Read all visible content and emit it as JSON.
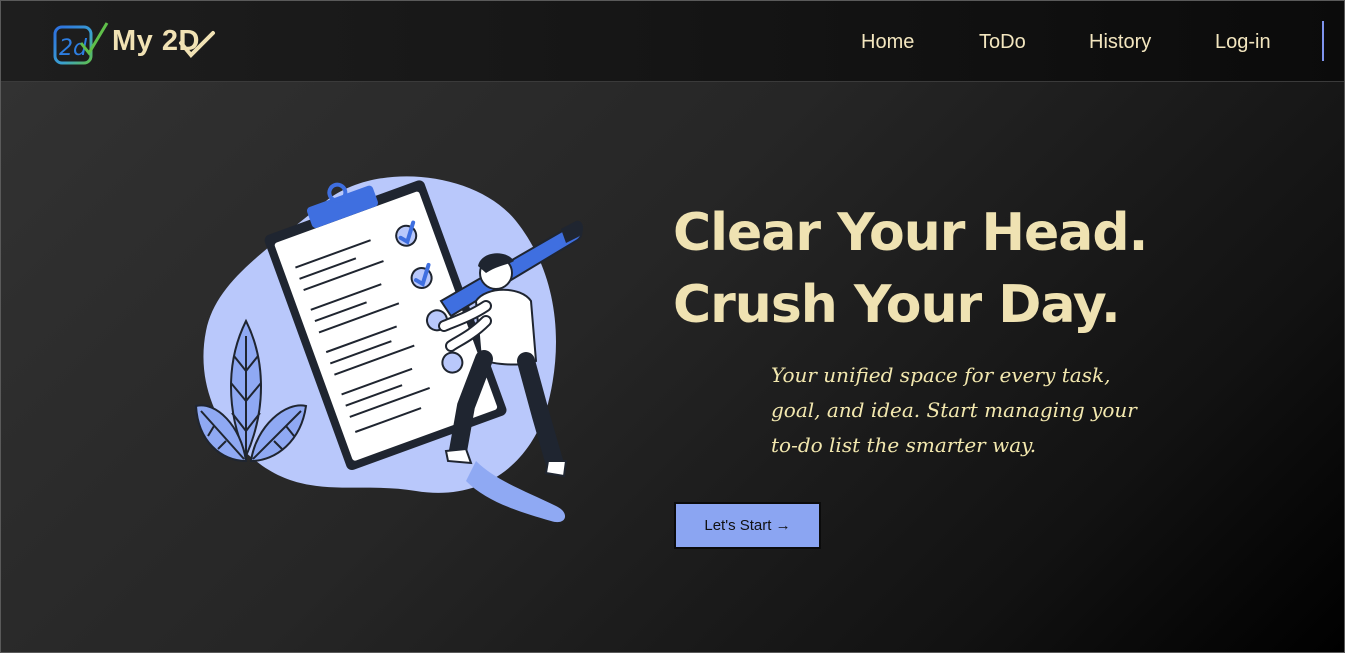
{
  "nav": {
    "brand": "My 2D",
    "links": [
      {
        "label": "Home"
      },
      {
        "label": "ToDo"
      },
      {
        "label": "History"
      },
      {
        "label": "Log-in"
      }
    ]
  },
  "hero": {
    "headline_line1": "Clear Your Head.",
    "headline_line2": "Crush Your Day.",
    "subtext": "Your unified space for every task, goal, and idea. Start managing your to-do list the smarter way.",
    "cta_label": "Let's Start →"
  },
  "colors": {
    "accent": "#8ba5f2",
    "headline": "#efe2b2",
    "nav_text": "#f3e6bf",
    "illustration_blue": "#3f6fe0",
    "illustration_light": "#b9c8fb"
  },
  "icons": [
    "logo-icon",
    "checkmark-icon",
    "clipboard-illustration"
  ]
}
